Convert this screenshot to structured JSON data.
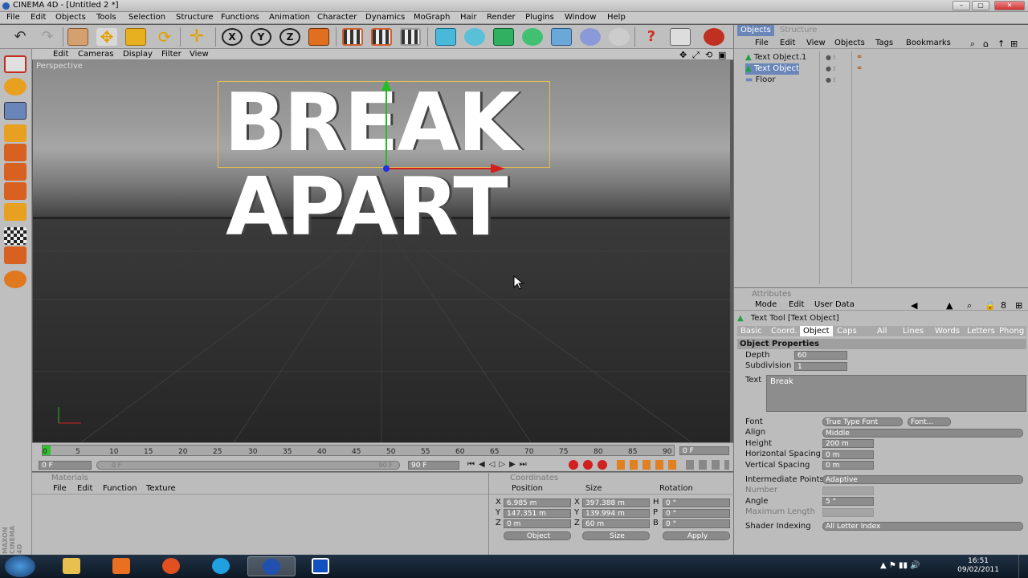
{
  "window": {
    "title": "CINEMA 4D - [Untitled 2 *]",
    "min": "–",
    "max": "▢",
    "close": "✕"
  },
  "menu": [
    "File",
    "Edit",
    "Objects",
    "Tools",
    "Selection",
    "Structure",
    "Functions",
    "Animation",
    "Character",
    "Dynamics",
    "MoGraph",
    "Hair",
    "Render",
    "Plugins",
    "Window",
    "Help"
  ],
  "toolbar_axes": [
    "X",
    "Y",
    "Z"
  ],
  "viewport": {
    "menu": [
      "Edit",
      "Cameras",
      "Display",
      "Filter",
      "View"
    ],
    "label": "Perspective",
    "text_line1": "BREAK",
    "text_line2": "APART"
  },
  "timeline": {
    "ticks": [
      "0",
      "5",
      "10",
      "15",
      "20",
      "25",
      "30",
      "35",
      "40",
      "45",
      "50",
      "55",
      "60",
      "65",
      "70",
      "75",
      "80",
      "85",
      "90"
    ],
    "frame_display": "0 F",
    "start_field": "0 F",
    "range_start": "0 F",
    "range_end": "90 F",
    "end_field": "90 F"
  },
  "objects_panel": {
    "tabs": [
      "Objects",
      "Structure"
    ],
    "menu": [
      "File",
      "Edit",
      "View",
      "Objects",
      "Tags",
      "Bookmarks"
    ],
    "items": [
      {
        "name": "Text Object.1",
        "selected": false
      },
      {
        "name": "Text Object",
        "selected": true
      },
      {
        "name": "Floor",
        "selected": false
      }
    ]
  },
  "attributes": {
    "title": "Attributes",
    "menu": [
      "Mode",
      "Edit",
      "User Data"
    ],
    "tool_label": "Text Tool [Text Object]",
    "tabs": [
      "Basic",
      "Coord.",
      "Object",
      "Caps",
      "All",
      "Lines",
      "Words",
      "Letters",
      "Phong"
    ],
    "active_tab": "Object",
    "section": "Object Properties",
    "depth_label": "Depth",
    "depth": "60",
    "subdivision_label": "Subdivision",
    "subdivision": "1",
    "text_label": "Text",
    "text_value": "Break",
    "font_label": "Font",
    "font_type": "True Type Font",
    "font_button": "Font...",
    "align_label": "Align",
    "align": "Middle",
    "height_label": "Height",
    "height": "200 m",
    "hspacing_label": "Horizontal Spacing",
    "hspacing": "0 m",
    "vspacing_label": "Vertical Spacing",
    "vspacing": "0 m",
    "interp_label": "Intermediate Points",
    "interp": "Adaptive",
    "number_label": "Number",
    "angle_label": "Angle",
    "angle": "5 °",
    "maxlen_label": "Maximum Length",
    "shader_label": "Shader Indexing",
    "shader": "All Letter Index"
  },
  "materials": {
    "title": "Materials",
    "menu": [
      "File",
      "Edit",
      "Function",
      "Texture"
    ]
  },
  "coordinates": {
    "title": "Coordinates",
    "headers": [
      "Position",
      "Size",
      "Rotation"
    ],
    "rows": [
      {
        "axis": "X",
        "pos": "6.985 m",
        "saxis": "X",
        "size": "397.388 m",
        "raxis": "H",
        "rot": "0 °"
      },
      {
        "axis": "Y",
        "pos": "147.351 m",
        "saxis": "Y",
        "size": "139.994 m",
        "raxis": "P",
        "rot": "0 °"
      },
      {
        "axis": "Z",
        "pos": "0 m",
        "saxis": "Z",
        "size": "60 m",
        "raxis": "B",
        "rot": "0 °"
      }
    ],
    "mode1": "Object",
    "mode2": "Size",
    "apply": "Apply"
  },
  "brand": "MAXON CINEMA 4D",
  "taskbar": {
    "time": "16:51",
    "date": "09/02/2011"
  },
  "colors": {
    "accent": "#6a86b8",
    "selection": "#e8c050"
  }
}
